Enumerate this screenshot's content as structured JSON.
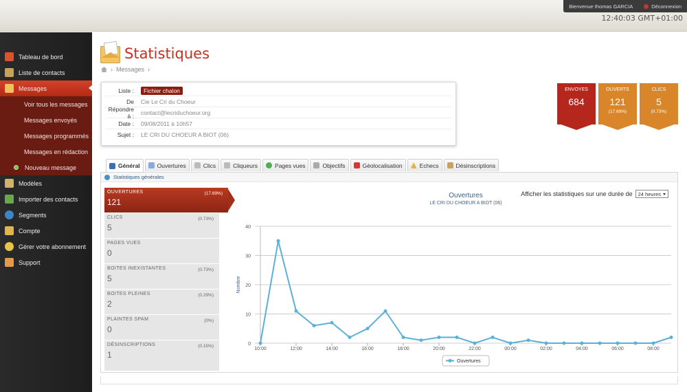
{
  "topbar": {
    "welcome": "Bienvenue thomas GARCIA",
    "logout": "Déconnexion",
    "clock": "12:40:03 GMT+01:00"
  },
  "sidebar": {
    "items": [
      {
        "label": "Tableau de bord",
        "icon": "home-icon",
        "color": "#d9532b"
      },
      {
        "label": "Liste de contacts",
        "icon": "address-book-icon",
        "color": "#c9a25a"
      },
      {
        "label": "Messages",
        "icon": "envelope-icon",
        "color": "#f1c15c"
      },
      {
        "label": "Modèles",
        "icon": "templates-icon",
        "color": "#d1b46c"
      },
      {
        "label": "Importer des contacts",
        "icon": "import-icon",
        "color": "#6aa84f"
      },
      {
        "label": "Segments",
        "icon": "globe-icon",
        "color": "#3d85c6"
      },
      {
        "label": "Compte",
        "icon": "key-icon",
        "color": "#e0b54d"
      },
      {
        "label": "Gérer votre abonnement",
        "icon": "coins-icon",
        "color": "#e8c34a"
      },
      {
        "label": "Support",
        "icon": "support-icon",
        "color": "#e59a4b"
      }
    ],
    "submenu": [
      "Voir tous les messages",
      "Messages envoyés",
      "Messages programmés",
      "Messages en rédaction"
    ],
    "new_message": "Nouveau message"
  },
  "page": {
    "title": "Statistiques",
    "breadcrumb": "Messages"
  },
  "info": {
    "liste_label": "Liste :",
    "liste_value": "Fichier chalon",
    "de_label": "De",
    "de_value": "Cie Le Cri du Choeur",
    "reply_label": "Répondre à :",
    "reply_value": "contact@lecriduchoeur.org",
    "date_label": "Date :",
    "date_value": "09/08/2011 à 10h57",
    "sujet_label": "Sujet :",
    "sujet_value": "LE CRI DU CHOEUR A BIOT (06)"
  },
  "stats": [
    {
      "label": "ENVOYES",
      "value": "684",
      "pct": "",
      "color": "#b5261d"
    },
    {
      "label": "OUVERTS",
      "value": "121",
      "pct": "(17.69%)",
      "color": "#d9862a"
    },
    {
      "label": "CLICS",
      "value": "5",
      "pct": "(0.73%)",
      "color": "#d9862a"
    }
  ],
  "tabs": [
    {
      "label": "Général",
      "color": "#3d6fb8"
    },
    {
      "label": "Ouvertures",
      "color": "#8aa8d8"
    },
    {
      "label": "Clics",
      "color": "#999"
    },
    {
      "label": "Cliqueurs",
      "color": "#999"
    },
    {
      "label": "Pages vues",
      "color": "#4caf50"
    },
    {
      "label": "Objectifs",
      "color": "#aaa"
    },
    {
      "label": "Géolocalisation",
      "color": "#d33"
    },
    {
      "label": "Echecs",
      "color": "#e6b34a"
    },
    {
      "label": "Désinscriptions",
      "color": "#c9a25a"
    }
  ],
  "panel": {
    "section": "Statistiques générales",
    "duration_label": "Afficher les statistiques sur une durée de",
    "duration_value": "24 heures"
  },
  "metrics": [
    {
      "label": "OUVERTURES",
      "pct": "(17.69%)",
      "value": "121"
    },
    {
      "label": "CLICS",
      "pct": "(0.73%)",
      "value": "5"
    },
    {
      "label": "PAGES VUES",
      "pct": "",
      "value": "0"
    },
    {
      "label": "BOITES INEXISTANTES",
      "pct": "(0.73%)",
      "value": "5"
    },
    {
      "label": "BOITES PLEINES",
      "pct": "(0.29%)",
      "value": "2"
    },
    {
      "label": "PLAINTES SPAM",
      "pct": "(0%)",
      "value": "0"
    },
    {
      "label": "DÉSINSCRIPTIONS",
      "pct": "(0.15%)",
      "value": "1"
    }
  ],
  "chart_data": {
    "type": "line",
    "title": "Ouvertures",
    "subtitle": "LE CRI DU CHOEUR A BIOT (06)",
    "ylabel": "Nombre",
    "xlabel": "",
    "x_ticks": [
      "10:00",
      "12:00",
      "14:00",
      "16:00",
      "18:00",
      "20:00",
      "22:00",
      "00:00",
      "02:00",
      "04:00",
      "06:00",
      "08:00"
    ],
    "ylim": [
      0,
      40
    ],
    "y_ticks": [
      0,
      10,
      20,
      30,
      40
    ],
    "grid": true,
    "legend": "bottom",
    "line_color": "#5ab0d6",
    "series": [
      {
        "name": "Ouvertures",
        "x": [
          "10:00",
          "11:00",
          "12:00",
          "13:00",
          "14:00",
          "15:00",
          "16:00",
          "17:00",
          "18:00",
          "19:00",
          "20:00",
          "21:00",
          "22:00",
          "23:00",
          "00:00",
          "01:00",
          "02:00",
          "03:00",
          "04:00",
          "05:00",
          "06:00",
          "07:00",
          "08:00",
          "09:00"
        ],
        "values": [
          0,
          35,
          11,
          6,
          7,
          2,
          5,
          11,
          2,
          1,
          2,
          2,
          0,
          2,
          0,
          1,
          0,
          0,
          0,
          0,
          0,
          0,
          0,
          2
        ]
      }
    ]
  }
}
